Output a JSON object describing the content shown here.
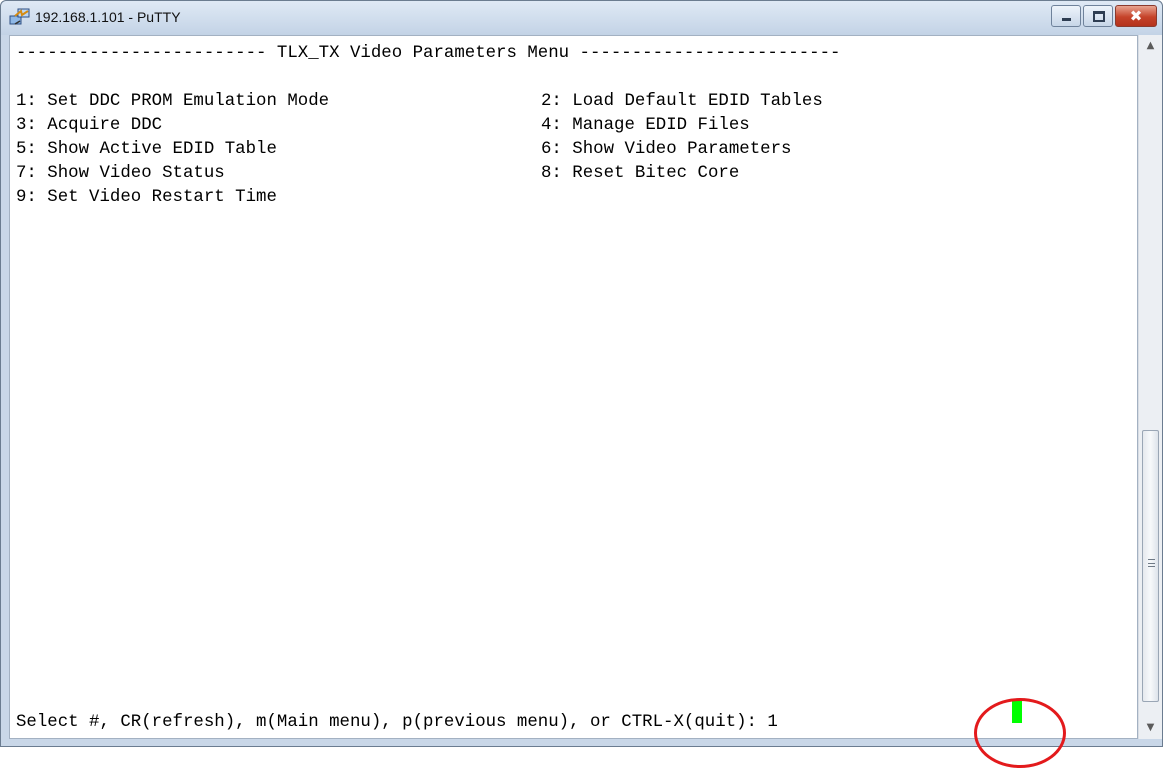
{
  "window": {
    "title": "192.168.1.101 - PuTTY",
    "icons": {
      "app": "putty-icon",
      "minimize": "minimize-icon",
      "maximize": "maximize-icon",
      "close": "close-icon"
    },
    "close_glyph": "✖"
  },
  "terminal": {
    "header": "------------------------ TLX_TX Video Parameters Menu -------------------------",
    "menu_left": [
      "1: Set DDC PROM Emulation Mode",
      "3: Acquire DDC",
      "5: Show Active EDID Table",
      "7: Show Video Status",
      "9: Set Video Restart Time"
    ],
    "menu_right": [
      "2: Load Default EDID Tables",
      "4: Manage EDID Files",
      "6: Show Video Parameters",
      "8: Reset Bitec Core"
    ],
    "prompt": "Select #, CR(refresh), m(Main menu), p(previous menu), or CTRL-X(quit): 1",
    "cursor_color": "#00ff00"
  },
  "scrollbar": {
    "up_icon": "scroll-up-arrow-icon",
    "down_icon": "scroll-down-arrow-icon",
    "up_glyph": "▲",
    "down_glyph": "▼"
  },
  "annotation": {
    "color": "#e31a1c",
    "shape": "circle"
  }
}
